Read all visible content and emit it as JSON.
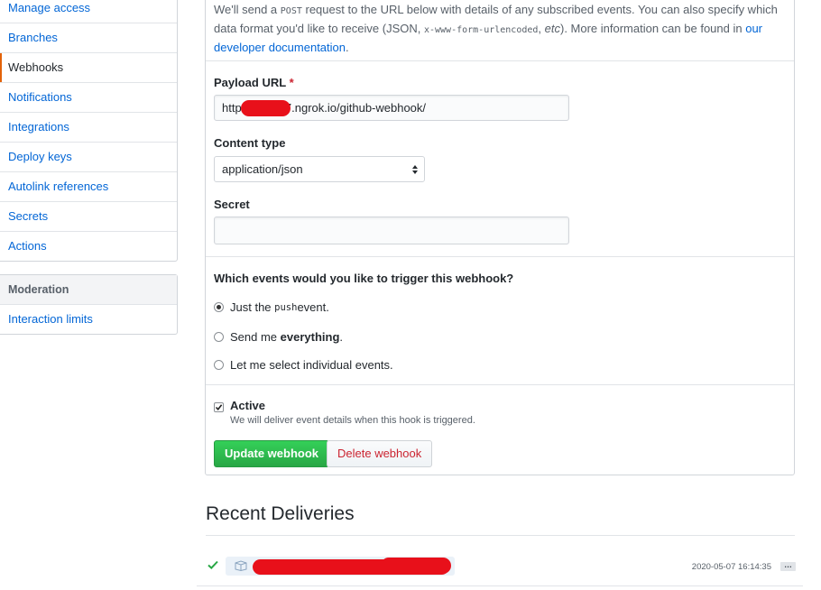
{
  "sidebar": {
    "items": [
      {
        "label": "Manage access"
      },
      {
        "label": "Branches"
      },
      {
        "label": "Webhooks",
        "selected": true
      },
      {
        "label": "Notifications"
      },
      {
        "label": "Integrations"
      },
      {
        "label": "Deploy keys"
      },
      {
        "label": "Autolink references"
      },
      {
        "label": "Secrets"
      },
      {
        "label": "Actions"
      }
    ],
    "moderation": {
      "heading": "Moderation",
      "items": [
        {
          "label": "Interaction limits"
        }
      ]
    }
  },
  "intro": {
    "part1": "We'll send a ",
    "post": "POST",
    "part2": " request to the URL below with details of any subscribed events. You can also specify which data format you'd like to receive (JSON, ",
    "form": "x-www-form-urlencoded",
    "part3": ", ",
    "etc": "etc",
    "part4": "). More information can be found in ",
    "link": "our developer documentation",
    "part5": "."
  },
  "form": {
    "payload_url_label": "Payload URL",
    "required_marker": "*",
    "payload_url_prefix": "http:/",
    "payload_url_suffix": "7.ngrok.io/github-webhook/",
    "content_type_label": "Content type",
    "content_type_value": "application/json",
    "secret_label": "Secret",
    "secret_value": "",
    "events_question": "Which events would you like to trigger this webhook?",
    "events": [
      {
        "before": "Just the ",
        "code": "push",
        "after": " event.",
        "checked": true
      },
      {
        "before": "Send me ",
        "strong": "everything",
        "after": ".",
        "checked": false
      },
      {
        "before": "Let me select individual events.",
        "checked": false
      }
    ],
    "active_label": "Active",
    "active_checked": true,
    "active_note": "We will deliver event details when this hook is triggered.",
    "update_button": "Update webhook",
    "delete_button": "Delete webhook"
  },
  "deliveries": {
    "title": "Recent Deliveries",
    "rows": [
      {
        "status": "success",
        "timestamp": "2020-05-07 16:14:35",
        "more": "…"
      }
    ]
  },
  "colors": {
    "link": "#0366d6",
    "selected_marker": "#e36209",
    "primary_button": "#28a745",
    "danger_text": "#cb2431",
    "redaction": "#e8101a"
  },
  "icons": {
    "select_arrow": "select-arrows-icon",
    "check": "check-icon",
    "package": "package-icon"
  }
}
